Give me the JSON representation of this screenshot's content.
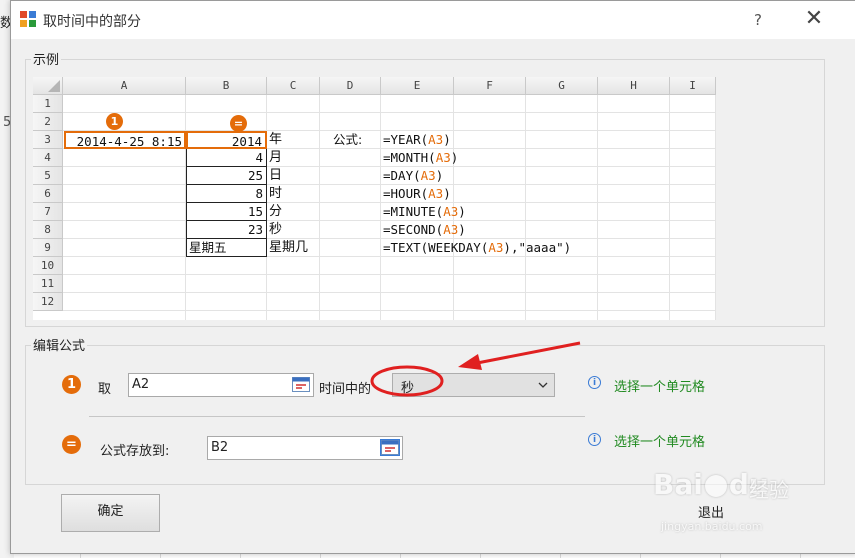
{
  "background": {
    "peek_char": "数",
    "peek_char2": "5"
  },
  "dialog": {
    "title": "取时间中的部分",
    "help": "?",
    "close": "✕"
  },
  "example": {
    "legend": "示例",
    "columns": [
      "A",
      "B",
      "C",
      "D",
      "E",
      "F",
      "G",
      "H",
      "I"
    ],
    "rows": [
      "1",
      "2",
      "3",
      "4",
      "5",
      "6",
      "7",
      "8",
      "9",
      "10",
      "11",
      "12"
    ],
    "marker1": "1",
    "marker2": "=",
    "a3": "2014-4-25 8:15",
    "b_values": [
      "2014",
      "4",
      "25",
      "8",
      "15",
      "23",
      "星期五"
    ],
    "c_units": [
      "年",
      "月",
      "日",
      "时",
      "分",
      "秒",
      "星期几"
    ],
    "formula_label": "公式:",
    "formulas": [
      {
        "pre": "=YEAR(",
        "ref": "A3",
        "post": ")"
      },
      {
        "pre": "=MONTH(",
        "ref": "A3",
        "post": ")"
      },
      {
        "pre": "=DAY(",
        "ref": "A3",
        "post": ")"
      },
      {
        "pre": "=HOUR(",
        "ref": "A3",
        "post": ")"
      },
      {
        "pre": "=MINUTE(",
        "ref": "A3",
        "post": ")"
      },
      {
        "pre": "=SECOND(",
        "ref": "A3",
        "post": ")"
      },
      {
        "pre": "=TEXT(WEEKDAY(",
        "ref": "A3",
        "post": "),\"aaaa\")"
      }
    ]
  },
  "edit": {
    "legend": "编辑公式",
    "step1_marker": "1",
    "take_label": "取",
    "source_value": "A2",
    "time_label": "时间中的",
    "part_selected": "秒",
    "hint1": "选择一个单元格",
    "step2_marker": "=",
    "store_label": "公式存放到:",
    "target_value": "B2",
    "hint2": "选择一个单元格"
  },
  "buttons": {
    "ok": "确定",
    "exit": "退出"
  },
  "watermark": {
    "brand": "Bai",
    "brand2": "du",
    "cn": "经验",
    "url": "jingyan.baidu.com"
  },
  "colors": {
    "accent": "#e46c0a",
    "hint": "#218a21",
    "annotation": "#e02020"
  }
}
